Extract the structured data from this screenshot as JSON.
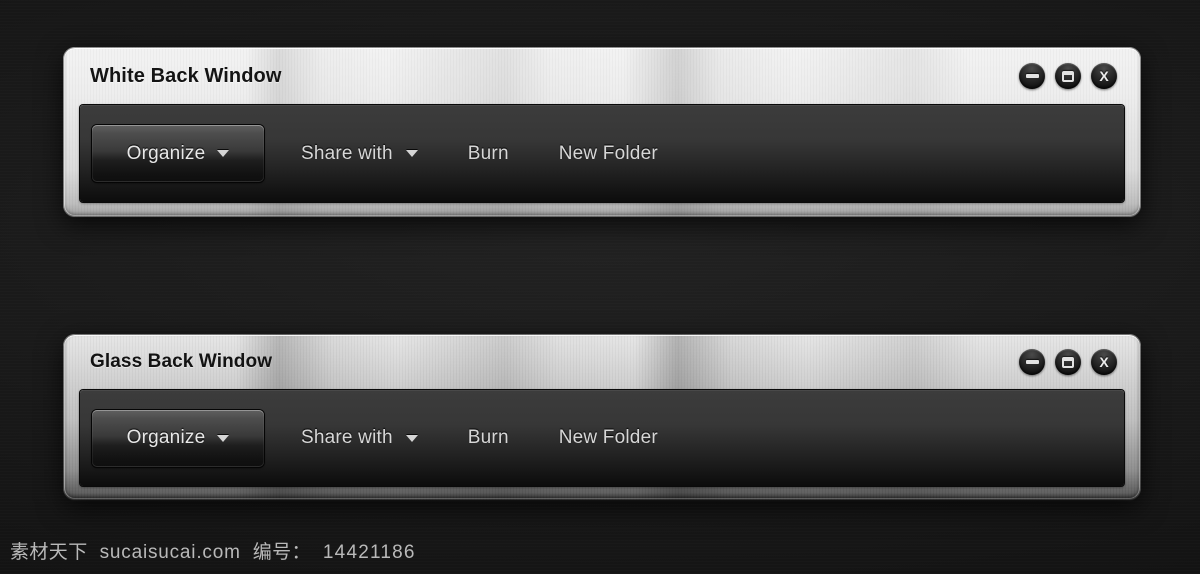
{
  "page": {
    "background_color": "#1a1a1a"
  },
  "windows": [
    {
      "id": "white-back-window",
      "title": "White Back Window",
      "titlebar_style": "white brushed metal",
      "controls": [
        {
          "name": "minimize",
          "glyph": "minimize-icon",
          "label": "–"
        },
        {
          "name": "maximize",
          "glyph": "maximize-icon",
          "label": "▣"
        },
        {
          "name": "close",
          "glyph": "close-icon",
          "label": "X"
        }
      ],
      "toolbar": {
        "primary_button": {
          "label": "Organize",
          "has_caret": true
        },
        "items": [
          {
            "label": "Share with",
            "has_caret": true
          },
          {
            "label": "Burn",
            "has_caret": false
          },
          {
            "label": "New Folder",
            "has_caret": false
          }
        ]
      }
    },
    {
      "id": "glass-back-window",
      "title": "Glass Back Window",
      "titlebar_style": "glass gradient metal",
      "controls": [
        {
          "name": "minimize",
          "glyph": "minimize-icon",
          "label": "–"
        },
        {
          "name": "maximize",
          "glyph": "maximize-icon",
          "label": "▣"
        },
        {
          "name": "close",
          "glyph": "close-icon",
          "label": "X"
        }
      ],
      "toolbar": {
        "primary_button": {
          "label": "Organize",
          "has_caret": true
        },
        "items": [
          {
            "label": "Share with",
            "has_caret": true
          },
          {
            "label": "Burn",
            "has_caret": false
          },
          {
            "label": "New Folder",
            "has_caret": false
          }
        ]
      }
    }
  ],
  "watermark": {
    "brand": "素材天下",
    "site": "sucaisucai.com",
    "id_label": "编号：",
    "id_value": "14421186"
  }
}
